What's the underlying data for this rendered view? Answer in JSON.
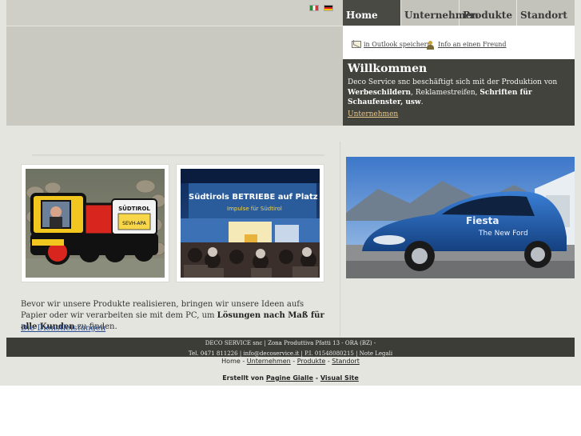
{
  "languages": [
    {
      "name": "italian-flag-icon"
    },
    {
      "name": "german-flag-icon"
    }
  ],
  "nav": {
    "items": [
      {
        "label": "Home",
        "active": true
      },
      {
        "label": "Unternehmen"
      },
      {
        "label": "Produkte"
      },
      {
        "label": "Standort"
      }
    ]
  },
  "links": {
    "outlook": "in Outlook speichern",
    "friend": "Info an einen Freund"
  },
  "welcome": {
    "title": "Willkommen",
    "text_1": "Deco Service snc beschäftigt sich mit der Produktion von ",
    "bold_1": "Werbeschildern",
    "text_2": ", Reklamestreifen, ",
    "bold_2": "Schriften für Schaufenster, usw",
    "text_3": ".",
    "link": "Unternehmen"
  },
  "photos": {
    "photo1_sign_top": "SÜDTIROL",
    "photo1_sign_bottom": "SEVH-APA",
    "photo2_banner_1": "Südtirols BETRIEBE auf Platz 1!",
    "photo2_banner_2": "Impulse für Südtirol",
    "car_text_1": "Fiesta",
    "car_text_2": "The New Ford"
  },
  "intro": {
    "text_1": "Bevor wir unsere Produkte realisieren, bringen wir unsere Ideen aufs Papier oder wir verarbeiten sie mit dem PC, um ",
    "bold": "Lösungen nach Maß für alle Kunden",
    "text_2": " zu finden.",
    "link": "Die Dienstleistungen"
  },
  "footer": {
    "line1": "DECO SERVICE snc | Zona Produttiva Pfatti 13 - ORA (BZ) -",
    "line2": "Tel. 0471 811226 | info@decoservice.it | P.I. 01548080215 | Note Legali"
  },
  "bottom_nav": {
    "home": "Home",
    "sep": "-",
    "unternehmen": "Unternehmen",
    "produkte": "Produkte",
    "standort": "Standort"
  },
  "created": {
    "prefix": "Erstellt von",
    "link1": "Pagine Gialle",
    "sep": "-",
    "link2": "Visual Site"
  },
  "colors": {
    "nav_active_bg": "#4a4a44",
    "welcome_bg": "#43433d",
    "footer_bg": "#3d3d38",
    "link_gold": "#e9c98b",
    "page_bg": "#e5e5df"
  }
}
